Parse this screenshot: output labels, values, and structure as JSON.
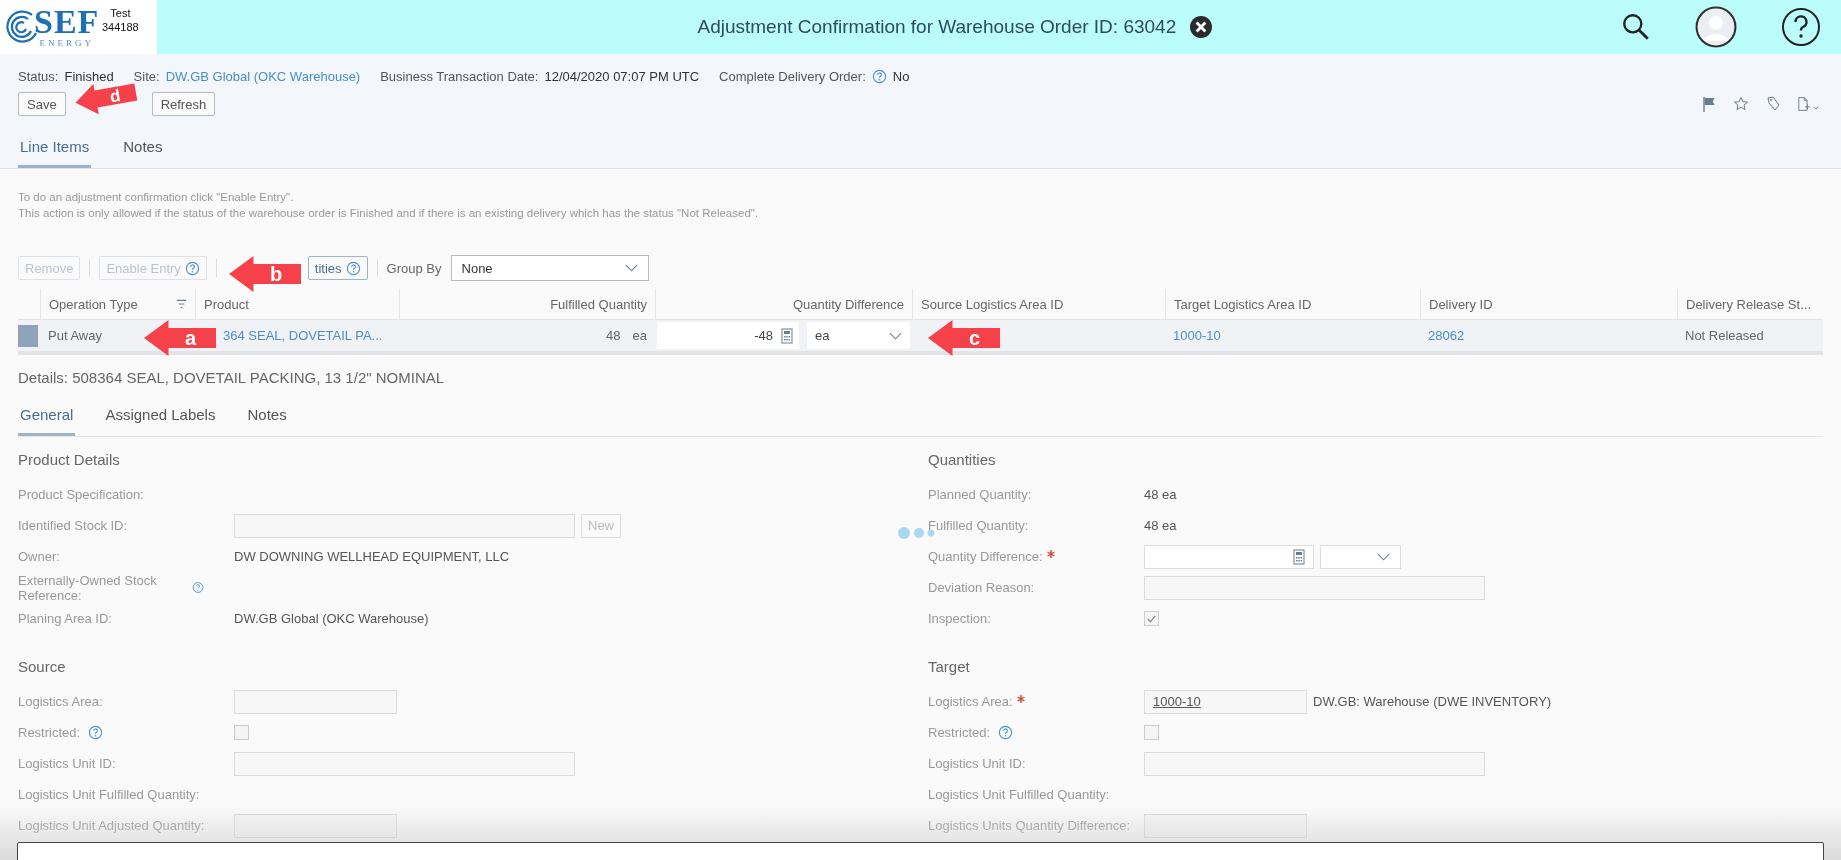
{
  "shell": {
    "logo": {
      "name": "SEF",
      "sub": "ENERGY"
    },
    "user_tag": [
      "Test",
      "344188"
    ],
    "title": "Adjustment Confirmation for Warehouse Order ID: 63042"
  },
  "object_header": {
    "fields": [
      {
        "label": "Status:",
        "value": "Finished",
        "kind": "text"
      },
      {
        "label": "Site:",
        "value": "DW.GB Global (OKC Warehouse)",
        "kind": "link"
      },
      {
        "label": "Business Transaction Date:",
        "value": "12/04/2020 07:07 PM UTC",
        "kind": "text"
      },
      {
        "label": "Complete Delivery Order:",
        "value": "No",
        "kind": "help"
      }
    ],
    "buttons": [
      {
        "label": "Save",
        "kind": "text"
      },
      {
        "label": "Refresh",
        "kind": "text"
      }
    ]
  },
  "tabs": [
    {
      "label": "Line Items",
      "selected": true
    },
    {
      "label": "Notes",
      "selected": false
    }
  ],
  "info": [
    "To do an adjustment confirmation click \"Enable Entry\".",
    "This action is only allowed if the status of the warehouse order is Finished and if there is an existing delivery which has the status \"Not Released\"."
  ],
  "table_toolbar": {
    "buttons": [
      {
        "label": "Remove",
        "disabled": true,
        "help": false
      },
      {
        "label": "Enable Entry",
        "disabled": true,
        "help": true
      },
      {
        "label": "tities",
        "disabled": false,
        "help": true
      }
    ],
    "group_by": {
      "label": "Group By",
      "value": "None"
    }
  },
  "table": {
    "columns": [
      "Operation Type",
      "Product",
      "Fulfilled Quantity",
      "Quantity Difference",
      "Source Logistics Area ID",
      "Target Logistics Area ID",
      "Delivery ID",
      "Delivery Release St..."
    ],
    "rows": [
      {
        "operation_type": "Put Away",
        "product": "364 SEAL, DOVETAIL PA...",
        "fulfilled_quantity": "48",
        "fulfilled_unit": "ea",
        "quantity_difference": "-48",
        "difference_unit": "ea",
        "target_logistics_area": "1000-10",
        "delivery_id": "28062",
        "release_status": "Not Released"
      }
    ]
  },
  "details": {
    "title": "Details: 508364 SEAL, DOVETAIL PACKING, 13 1/2\" NOMINAL",
    "tabs": [
      {
        "label": "General",
        "selected": true
      },
      {
        "label": "Assigned Labels",
        "selected": false
      },
      {
        "label": "Notes",
        "selected": false
      }
    ],
    "columns": [
      [
        {
          "title": "Product Details",
          "rows": [
            {
              "label": "Product Specification:",
              "kind": "empty"
            },
            {
              "label": "Identified Stock ID:",
              "kind": "field_long",
              "button": "New"
            },
            {
              "label": "Owner:",
              "kind": "link",
              "value": "DW DOWNING WELLHEAD EQUIPMENT, LLC"
            },
            {
              "label": "Externally-Owned Stock Reference:",
              "kind": "empty",
              "help": true
            },
            {
              "label": "Planing Area ID:",
              "kind": "text",
              "value": "DW.GB Global (OKC Warehouse)"
            }
          ]
        },
        {
          "title": "Source",
          "rows": [
            {
              "label": "Logistics Area:",
              "kind": "field_short"
            },
            {
              "label": "Restricted:",
              "kind": "checkbox",
              "help": true,
              "checked": false
            },
            {
              "label": "Logistics Unit ID:",
              "kind": "field_long"
            },
            {
              "label": "Logistics Unit Fulfilled Quantity:",
              "kind": "empty"
            },
            {
              "label": "Logistics Unit Adjusted Quantity:",
              "kind": "field_short"
            }
          ]
        }
      ],
      [
        {
          "title": "Quantities",
          "rows": [
            {
              "label": "Planned Quantity:",
              "kind": "text",
              "value": "48 ea"
            },
            {
              "label": "Fulfilled Quantity:",
              "kind": "text",
              "value": "48 ea"
            },
            {
              "label": "Quantity Difference:",
              "kind": "quantity",
              "required": true
            },
            {
              "label": "Deviation Reason:",
              "kind": "field_long"
            },
            {
              "label": "Inspection:",
              "kind": "checkbox",
              "checked": true
            }
          ]
        },
        {
          "title": "Target",
          "rows": [
            {
              "label": "Logistics Area:",
              "kind": "field_short",
              "required": true,
              "value": "1000-10",
              "link": "DW.GB: Warehouse (DWE INVENTORY)"
            },
            {
              "label": "Restricted:",
              "kind": "checkbox",
              "help": true,
              "checked": false
            },
            {
              "label": "Logistics Unit ID:",
              "kind": "field_long"
            },
            {
              "label": "Logistics Unit Fulfilled Quantity:",
              "kind": "empty"
            },
            {
              "label": "Logistics Units Quantity Difference:",
              "kind": "field_short"
            }
          ]
        }
      ]
    ]
  },
  "callouts": [
    {
      "letter": "d"
    },
    {
      "letter": "b"
    },
    {
      "letter": "a"
    },
    {
      "letter": "c"
    }
  ]
}
